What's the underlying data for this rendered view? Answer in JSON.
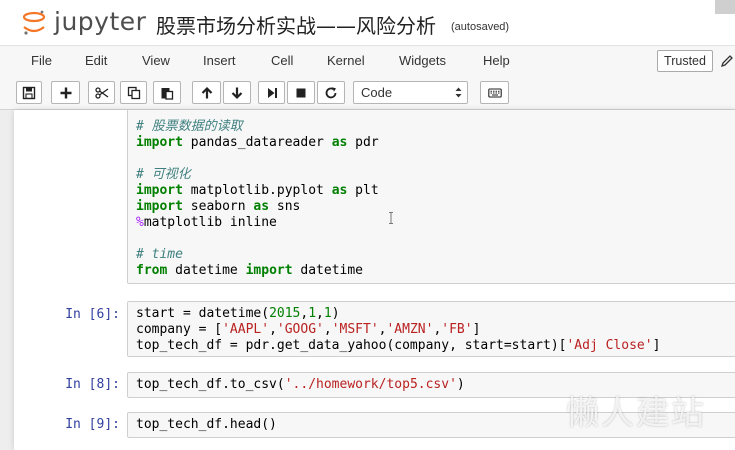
{
  "header": {
    "logo_text": "jupyter",
    "notebook_title": "股票市场分析实战——风险分析",
    "autosave_status": "(autosaved)"
  },
  "menubar": {
    "items": [
      "File",
      "Edit",
      "View",
      "Insert",
      "Cell",
      "Kernel",
      "Widgets",
      "Help"
    ],
    "trusted_label": "Trusted"
  },
  "toolbar": {
    "buttons": [
      "save-icon",
      "plus-icon",
      "cut-icon",
      "copy-icon",
      "paste-icon",
      "arrow-up-icon",
      "arrow-down-icon",
      "step-forward-icon",
      "stop-icon",
      "restart-icon",
      "keyboard-icon"
    ],
    "cell_type": "Code"
  },
  "cells": [
    {
      "prompt": "",
      "lines": [
        "# 股票数据的读取",
        "import pandas_datareader as pdr",
        "",
        "# 可视化",
        "import matplotlib.pyplot as plt",
        "import seaborn as sns",
        "%matplotlib inline",
        "",
        "# time",
        "from datetime import datetime"
      ]
    },
    {
      "prompt": "In [6]:",
      "lines": [
        "start = datetime(2015,1,1)",
        "company = ['AAPL','GOOG','MSFT','AMZN','FB']",
        "top_tech_df = pdr.get_data_yahoo(company, start=start)['Adj Close']"
      ]
    },
    {
      "prompt": "In [8]:",
      "lines": [
        "top_tech_df.to_csv('../homework/top5.csv')"
      ]
    },
    {
      "prompt": "In [9]:",
      "lines": [
        "top_tech_df.head()"
      ]
    }
  ],
  "watermark": "懒人建站"
}
